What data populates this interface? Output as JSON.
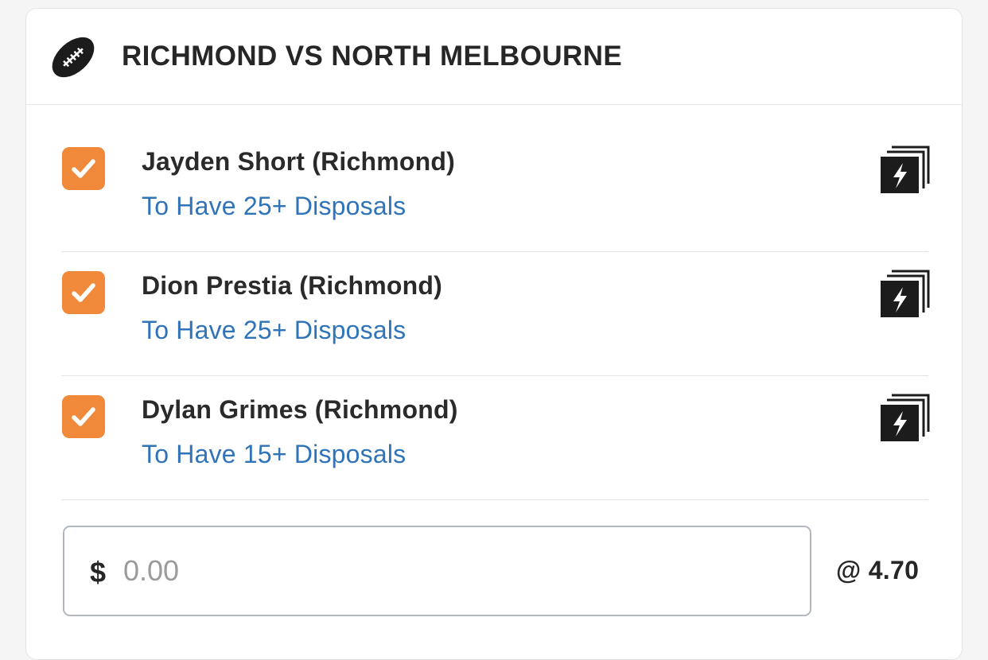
{
  "event": {
    "title": "RICHMOND VS NORTH MELBOURNE",
    "icon": "football-icon"
  },
  "legs": [
    {
      "checked": true,
      "selection": "Jayden Short (Richmond)",
      "market": "To Have 25+ Disposals",
      "icon": "same-game-multi-icon"
    },
    {
      "checked": true,
      "selection": "Dion Prestia (Richmond)",
      "market": "To Have 25+ Disposals",
      "icon": "same-game-multi-icon"
    },
    {
      "checked": true,
      "selection": "Dylan Grimes (Richmond)",
      "market": "To Have 15+ Disposals",
      "icon": "same-game-multi-icon"
    }
  ],
  "stake": {
    "currency": "$",
    "placeholder": "0.00",
    "value": ""
  },
  "odds": "@ 4.70",
  "colors": {
    "accent": "#f08a3a",
    "link": "#2f73b8",
    "text": "#262626",
    "divider": "#e3e3e5"
  }
}
